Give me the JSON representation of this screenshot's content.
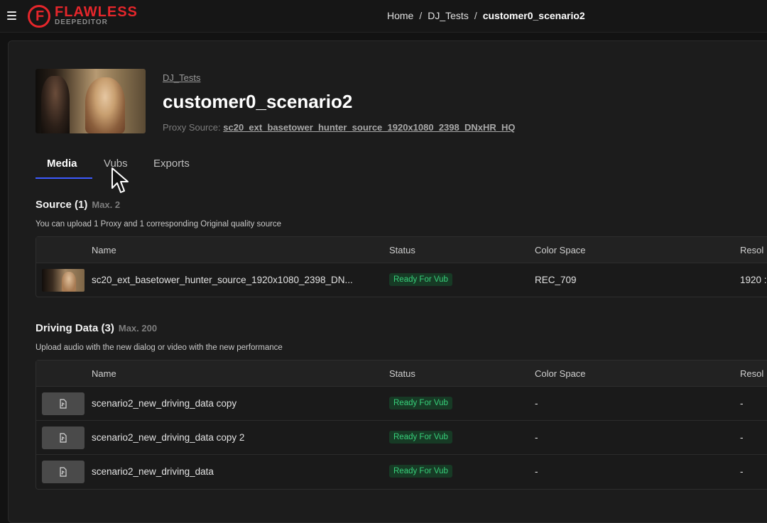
{
  "header": {
    "logo_main": "FLAWLESS",
    "logo_sub": "DEEPEDITOR",
    "logo_letter": "F",
    "breadcrumb": [
      "Home",
      "DJ_Tests",
      "customer0_scenario2"
    ],
    "accent_color": "#e5262b"
  },
  "project": {
    "parent_link": "DJ_Tests",
    "title": "customer0_scenario2",
    "proxy_label": "Proxy Source:",
    "proxy_value": "sc20_ext_basetower_hunter_source_1920x1080_2398_DNxHR_HQ"
  },
  "tabs": [
    {
      "label": "Media",
      "active": true
    },
    {
      "label": "Vubs",
      "active": false
    },
    {
      "label": "Exports",
      "active": false
    }
  ],
  "source": {
    "title": "Source (1)",
    "max": "Max. 2",
    "subtitle": "You can upload 1 Proxy and 1 corresponding Original quality source",
    "columns": [
      "Name",
      "Status",
      "Color Space",
      "Resol"
    ],
    "rows": [
      {
        "name": "sc20_ext_basetower_hunter_source_1920x1080_2398_DN...",
        "status": "Ready For Vub",
        "color_space": "REC_709",
        "resolution": "1920 :"
      }
    ]
  },
  "driving": {
    "title": "Driving Data (3)",
    "max": "Max. 200",
    "subtitle": "Upload audio with the new dialog or video with the new performance",
    "columns": [
      "Name",
      "Status",
      "Color Space",
      "Resol"
    ],
    "rows": [
      {
        "name": "scenario2_new_driving_data copy",
        "status": "Ready For Vub",
        "color_space": "-",
        "resolution": "-"
      },
      {
        "name": "scenario2_new_driving_data copy 2",
        "status": "Ready For Vub",
        "color_space": "-",
        "resolution": "-"
      },
      {
        "name": "scenario2_new_driving_data",
        "status": "Ready For Vub",
        "color_space": "-",
        "resolution": "-"
      }
    ]
  },
  "status_color": "#37d07a",
  "tab_accent": "#3d5afe",
  "icons": {
    "menu": "hamburger-icon",
    "file": "audio-file-icon",
    "cursor": "mouse-pointer-icon"
  }
}
